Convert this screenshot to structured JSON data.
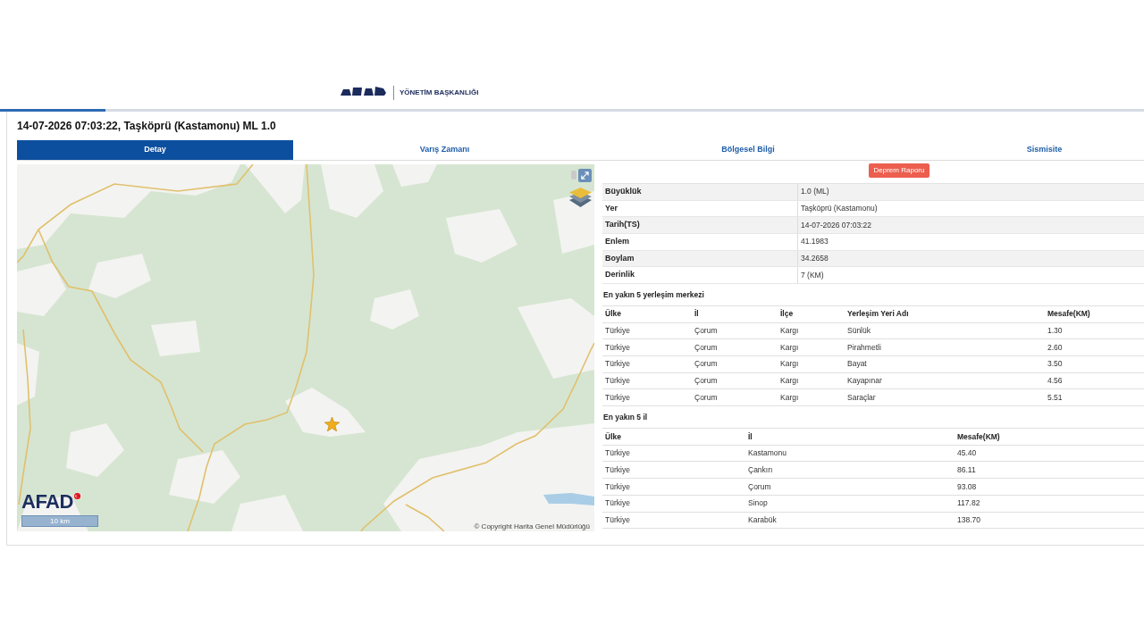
{
  "header": {
    "logo_subtitle": "YÖNETİM BAŞKANLIĞI"
  },
  "loading_bar": {
    "level": 0.092
  },
  "event_title": "14-07-2026 07:03:22, Taşköprü (Kastamonu) ML 1.0",
  "tabs": [
    {
      "label": "Detay",
      "selected": true
    },
    {
      "label": "Varış Zamanı",
      "selected": false
    },
    {
      "label": "Bölgesel Bilgi",
      "selected": false
    },
    {
      "label": "Sismisite",
      "selected": false
    }
  ],
  "map": {
    "logo": "AFAD",
    "scale": "10 km",
    "attribution": "© Copyright Harita Genel Müdürlüğü"
  },
  "report_button": "Deprem Raporu",
  "details": [
    {
      "label": "Büyüklük",
      "value": "1.0 (ML)"
    },
    {
      "label": "Yer",
      "value": "Taşköprü (Kastamonu)"
    },
    {
      "label": "Tarih(TS)",
      "value": "14-07-2026 07:03:22"
    },
    {
      "label": "Enlem",
      "value": "41.1983"
    },
    {
      "label": "Boylam",
      "value": "34.2658"
    },
    {
      "label": "Derinlik",
      "value": "7 (KM)"
    }
  ],
  "nearest_settlements": {
    "title": "En yakın 5 yerleşim merkezi",
    "columns": [
      "Ülke",
      "İl",
      "İlçe",
      "Yerleşim Yeri Adı",
      "Mesafe(KM)"
    ],
    "rows": [
      [
        "Türkiye",
        "Çorum",
        "Kargı",
        "Sünlük",
        "1.30"
      ],
      [
        "Türkiye",
        "Çorum",
        "Kargı",
        "Pirahmetli",
        "2.60"
      ],
      [
        "Türkiye",
        "Çorum",
        "Kargı",
        "Bayat",
        "3.50"
      ],
      [
        "Türkiye",
        "Çorum",
        "Kargı",
        "Kayapınar",
        "4.56"
      ],
      [
        "Türkiye",
        "Çorum",
        "Kargı",
        "Saraçlar",
        "5.51"
      ]
    ]
  },
  "nearest_provinces": {
    "title": "En yakın 5 il",
    "columns": [
      "Ülke",
      "İl",
      "Mesafe(KM)"
    ],
    "rows": [
      [
        "Türkiye",
        "Kastamonu",
        "45.40"
      ],
      [
        "Türkiye",
        "Çankırı",
        "86.11"
      ],
      [
        "Türkiye",
        "Çorum",
        "93.08"
      ],
      [
        "Türkiye",
        "Sinop",
        "117.82"
      ],
      [
        "Türkiye",
        "Karabük",
        "138.70"
      ]
    ]
  }
}
